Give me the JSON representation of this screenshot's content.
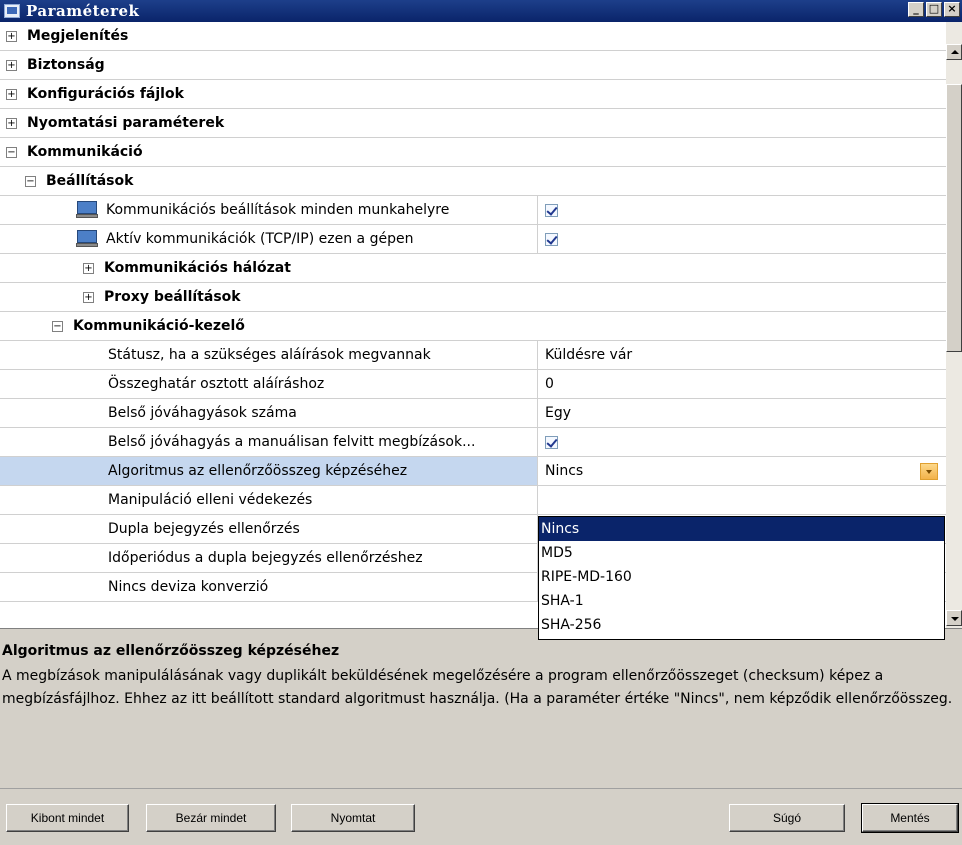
{
  "window": {
    "title": "Paraméterek",
    "minimize": "_",
    "maximize": "□",
    "close": "×"
  },
  "tree": {
    "categories": [
      {
        "label": "Megjelenítés",
        "expander": "+"
      },
      {
        "label": "Biztonság",
        "expander": "+"
      },
      {
        "label": "Konfigurációs fájlok",
        "expander": "+"
      },
      {
        "label": "Nyomtatási paraméterek",
        "expander": "+"
      },
      {
        "label": "Kommunikáció",
        "expander": "−"
      }
    ],
    "settings_group": {
      "label": "Beállítások",
      "expander": "−"
    },
    "settings_props": [
      {
        "name": "Kommunikációs beállítások minden munkahelyre",
        "checked": true
      },
      {
        "name": "Aktív kommunikációk (TCP/IP) ezen a gépen",
        "checked": true
      }
    ],
    "settings_subgroups": [
      {
        "label": "Kommunikációs hálózat",
        "expander": "+"
      },
      {
        "label": "Proxy beállítások",
        "expander": "+"
      }
    ],
    "manager_group": {
      "label": "Kommunikáció-kezelő",
      "expander": "−"
    },
    "manager_props": [
      {
        "name": "Státusz, ha a szükséges aláírások megvannak",
        "value": "Küldésre vár"
      },
      {
        "name": "Összeghatár osztott aláíráshoz",
        "value": "0"
      },
      {
        "name": "Belső jóváhagyások száma",
        "value": "Egy"
      },
      {
        "name": "Belső jóváhagyás a manuálisan felvitt megbízások...",
        "checked": true
      },
      {
        "name": "Algoritmus az ellenőrzőösszeg képzéséhez",
        "value": "Nincs",
        "selected": true
      },
      {
        "name": "Manipuláció elleni védekezés",
        "value": ""
      },
      {
        "name": "Dupla bejegyzés ellenőrzés",
        "value": ""
      },
      {
        "name": "Időperiódus a dupla bejegyzés ellenőrzéshez",
        "value": ""
      },
      {
        "name": "Nincs deviza konverzió",
        "value": ""
      }
    ]
  },
  "dropdown": {
    "options": [
      "Nincs",
      "MD5",
      "RIPE-MD-160",
      "SHA-1",
      "SHA-256"
    ],
    "selected": "Nincs"
  },
  "description": {
    "title": "Algoritmus az ellenőrzőösszeg képzéséhez",
    "body": "A megbízások manipulálásának vagy duplikált beküldésének megelőzésére a program ellenőrzőösszeget (checksum) képez a megbízásfájlhoz. Ehhez az itt beállított standard algoritmust használja. (Ha a paraméter értéke \"Nincs\", nem képződik ellenőrzőösszeg."
  },
  "buttons": {
    "expand_all": "Kibont mindet",
    "collapse_all": "Bezár mindet",
    "print": "Nyomtat",
    "help": "Súgó",
    "save": "Mentés"
  },
  "colors": {
    "titlebar": "#0a246a",
    "selected_row": "#c5d7ef",
    "dropdown_highlight": "#0a246a",
    "combo_button": "#f3b24a"
  }
}
